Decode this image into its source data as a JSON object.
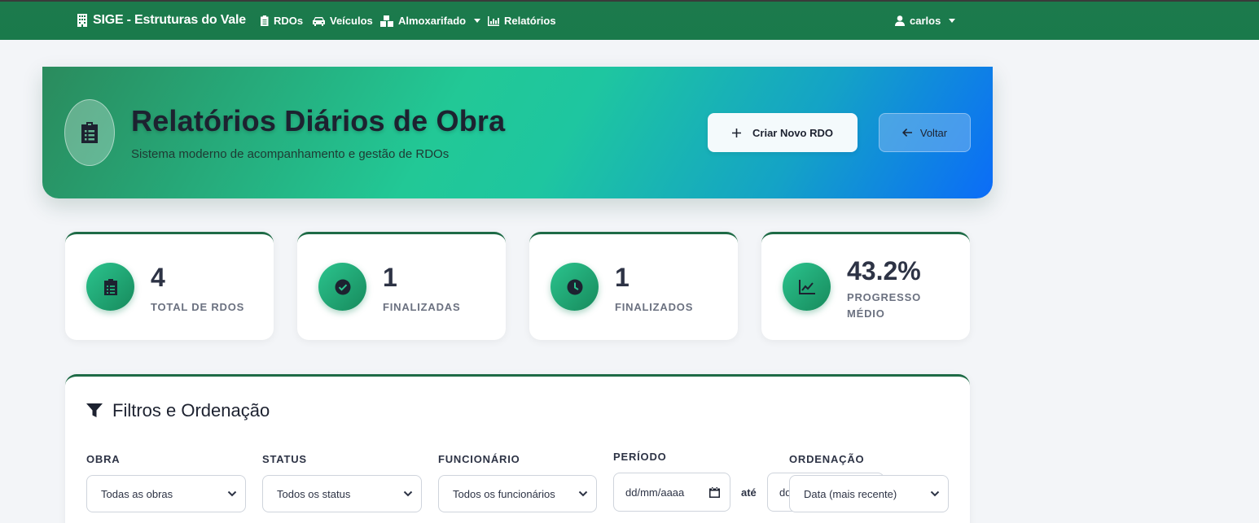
{
  "navbar": {
    "brand": "SIGE - Estruturas do Vale",
    "items": [
      {
        "label": "RDOs",
        "icon": "clipboard-icon"
      },
      {
        "label": "Veículos",
        "icon": "car-icon"
      },
      {
        "label": "Almoxarifado",
        "icon": "boxes-icon",
        "dropdown": true
      },
      {
        "label": "Relatórios",
        "icon": "chart-icon"
      }
    ],
    "user": "carlos"
  },
  "hero": {
    "title": "Relatórios Diários de Obra",
    "subtitle": "Sistema moderno de acompanhamento e gestão de RDOs",
    "new_button": "Criar Novo RDO",
    "back_button": "Voltar"
  },
  "stats": [
    {
      "value": "4",
      "label": "TOTAL DE RDOS",
      "icon": "clipboard-icon"
    },
    {
      "value": "1",
      "label": "FINALIZADAS",
      "icon": "check-circle-icon"
    },
    {
      "value": "1",
      "label": "FINALIZADOS",
      "icon": "clock-icon"
    },
    {
      "value": "43.2%",
      "label": "PROGRESSO MÉDIO",
      "icon": "chart-line-icon"
    }
  ],
  "filters": {
    "title": "Filtros e Ordenação",
    "obra_label": "OBRA",
    "obra_value": "Todas as obras",
    "status_label": "STATUS",
    "status_value": "Todos os status",
    "funcionario_label": "FUNCIONÁRIO",
    "funcionario_value": "Todos os funcionários",
    "periodo_label": "PERÍODO",
    "date_start_placeholder": "dd/mm/aaaa",
    "ate_label": "até",
    "date_end_placeholder": "dd/mm/aaaa",
    "ordenacao_label": "ORDENAÇÃO",
    "ordenacao_value": "Data (mais recente)"
  },
  "colors": {
    "navbar": "#1a7a4b",
    "accent": "#1e6b46",
    "hero_start": "#2a8b5d",
    "hero_end": "#0b6cf8"
  }
}
